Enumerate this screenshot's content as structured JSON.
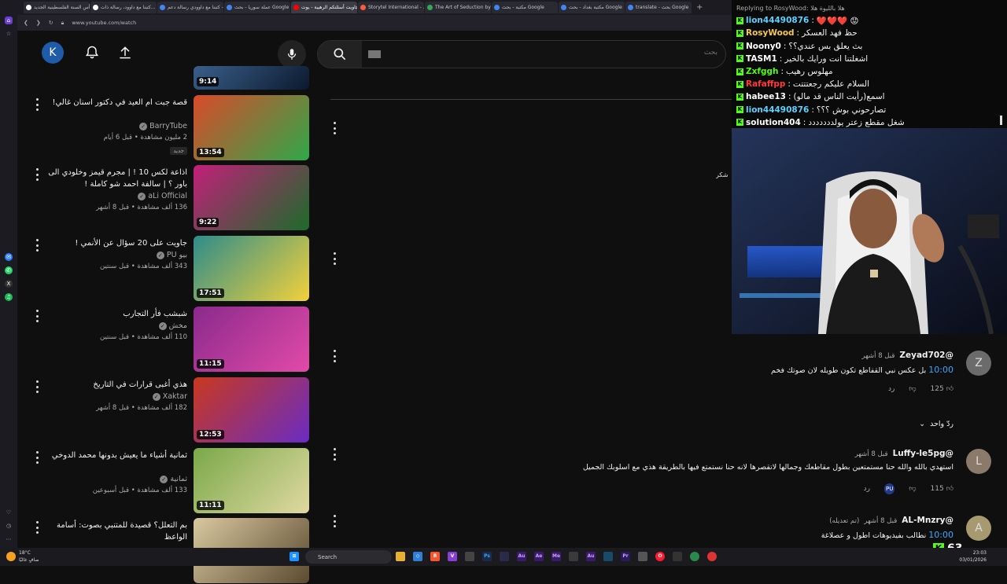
{
  "browser": {
    "tabs": [
      {
        "label": "رأس السنة الفلسطينية الجديد...",
        "favicon_color": "#ffffff"
      },
      {
        "label": "كتبنا مع داوود، رسالة ذات...",
        "favicon_color": "#ffffff"
      },
      {
        "label": "كتبنا مع داوودي رسالة دعم - ...",
        "favicon_color": "#4285f4"
      },
      {
        "label": "عملة سوريا - بحث Google",
        "favicon_color": "#4285f4"
      },
      {
        "label": "جاويت أسئلتكم الرهيبة - يوت...",
        "favicon_color": "#ff0000"
      },
      {
        "label": "Storytel International - ...",
        "favicon_color": "#ff5a3c"
      },
      {
        "label": "The Art of Seduction by R...",
        "favicon_color": "#34a853"
      },
      {
        "label": "مكتبة - بحث Google",
        "favicon_color": "#4285f4"
      },
      {
        "label": "مكتبة بغداد - بحث Google",
        "favicon_color": "#4285f4"
      },
      {
        "label": "translate - بحث Google",
        "favicon_color": "#4285f4"
      }
    ],
    "active_tab_index": 4,
    "new_tab_label": "+",
    "url": "www.youtube.com/watch"
  },
  "youtube": {
    "avatar_letter": "K",
    "search_placeholder": "بحث",
    "videos": [
      {
        "title": "",
        "channel": "",
        "meta": "",
        "duration": "9:14",
        "thumb_colors": [
          "#3a5f8a",
          "#0b1a2e"
        ]
      },
      {
        "title": "قصة جبت ام العيد في دكتور اسنان غالي!",
        "channel": "BarryTube",
        "meta": "2 مليون مشاهدة • قبل 6 أيام",
        "duration": "13:54",
        "badge": "جديد",
        "thumb_colors": [
          "#d94a2a",
          "#2ea84a"
        ]
      },
      {
        "title": "اذاعة لكس 10 ! | مجرم قيمز وخلودي الى باور ؟ | سالفة احمد شو كاملة !",
        "channel": "aLi Official",
        "meta": "136 ألف مشاهدة • قبل 8 أشهر",
        "duration": "9:22",
        "thumb_colors": [
          "#c21f7a",
          "#1d6b2a"
        ]
      },
      {
        "title": "جاويت على 20 سؤال عن الأنمي !",
        "channel": "بيو PU",
        "meta": "343 ألف مشاهدة • قبل سنتين",
        "duration": "17:51",
        "thumb_colors": [
          "#2e8c8a",
          "#f2d13c"
        ]
      },
      {
        "title": "شبشب فأر التجارب",
        "channel": "مخش",
        "meta": "110 ألف مشاهدة • قبل سنتين",
        "duration": "11:15",
        "thumb_colors": [
          "#8a2a8c",
          "#e24aa8"
        ]
      },
      {
        "title": "هذي أغبى قرارات في التاريخ",
        "channel": "Xaktar",
        "meta": "182 ألف مشاهدة • قبل 8 أشهر",
        "duration": "12:53",
        "thumb_colors": [
          "#c9381e",
          "#6a2cc4"
        ]
      },
      {
        "title": "ثمانية أشياء ما يعيش بدونها محمد الدوخي",
        "channel": "ثمانية",
        "meta": "133 ألف مشاهدة • قبل أسبوعين",
        "duration": "11:11",
        "thumb_colors": [
          "#7aa84a",
          "#e0d9a0"
        ]
      },
      {
        "title": "بم التعلل؟ قصيدة للمتنبي بصوت: أسامة الواعظ",
        "channel": "",
        "meta": "",
        "duration": "",
        "thumb_colors": [
          "#d9c9a0",
          "#5a4a30"
        ]
      }
    ],
    "side_text": "شكر",
    "comments": [
      {
        "name": "@Zeyad702",
        "time": "قبل 8 أشهر",
        "edited": "",
        "timestamp": "10:00",
        "text": "بل عكس نبي القفاطع تكون طويله لان صوتك فخم",
        "likes": "125",
        "reply_label": "رد",
        "replies_label": "ردّ واحد",
        "avatar_letter": "Z",
        "avatar_color": "#6b6b6b"
      },
      {
        "name": "@Luffy-le5pg",
        "time": "قبل 8 أشهر",
        "edited": "",
        "timestamp": "",
        "text": "استهدي بالله والله حنا مستمتعين بطول مقاطعك وجمالها لاتقصرها لانه حنا نستمتع فيها بالطريقة هذي مع اسلوبك الجميل",
        "likes": "115",
        "reply_label": "رد",
        "replies_label": "",
        "creator_heart": "PU",
        "avatar_letter": "L",
        "avatar_color": "#8a7a6a"
      },
      {
        "name": "@AL-Mnzry",
        "time": "قبل 8 أشهر",
        "edited": "(تم تعديله)",
        "timestamp": "10:00",
        "text": "نطالب بفيديوهات اطول و عصلاغة",
        "likes": "",
        "reply_label": "",
        "replies_label": "",
        "avatar_letter": "A",
        "avatar_color": "#a89a70"
      }
    ]
  },
  "chat": {
    "reply_line": "Replying to  RosyWood: هلا بالليوة هلا",
    "messages": [
      {
        "user": "lion44490876",
        "text": "❤️❤️❤️ 😟",
        "color": "#5ad1ff"
      },
      {
        "user": "RosyWood",
        "text": "حظ فهد العسكر",
        "color": "#f7c948"
      },
      {
        "user": "Noony0",
        "text": "بث يعلق بس عندي؟؟",
        "color": "#ffffff"
      },
      {
        "user": "TASM1",
        "text": "اشغلتنا انت ورايك بالخير",
        "color": "#ffffff"
      },
      {
        "user": "Zxfggh",
        "text": "مهلوس رهيب",
        "color": "#53fc18"
      },
      {
        "user": "Rafaffpp",
        "text": "السلام عليكم رجعتتتت",
        "color": "#ff3a3a"
      },
      {
        "user": "habee13",
        "text": "اسمع(رأيت الناس قد مالو)",
        "color": "#ffffff"
      },
      {
        "user": "lion44490876",
        "text": "تصارحوني بوش ؟؟؟",
        "color": "#5ad1ff"
      },
      {
        "user": "solution404",
        "text": "شغل مقطع زعتر يولددددددد",
        "color": "#ffffff"
      }
    ],
    "viewer_count": "63"
  },
  "taskbar": {
    "search_label": "Search",
    "weather": "18°C",
    "weather_sub": "صافٍ غالبًا",
    "time": "23:03",
    "date": "03/01/2026"
  }
}
